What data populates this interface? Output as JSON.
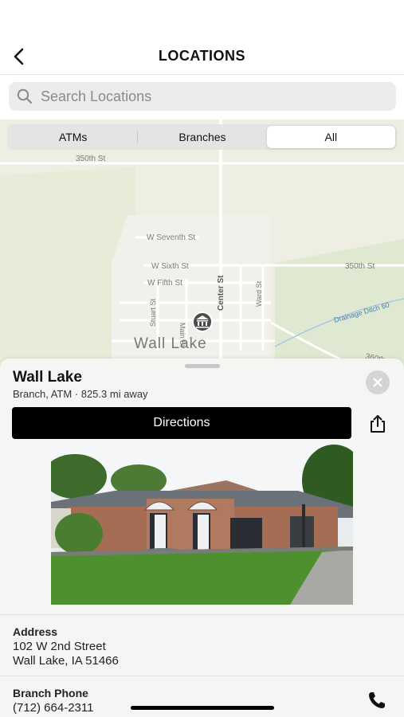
{
  "header": {
    "title": "LOCATIONS",
    "back_icon": "chevron-left-icon"
  },
  "search": {
    "placeholder": "Search Locations",
    "value": ""
  },
  "filter": {
    "options": [
      "ATMs",
      "Branches",
      "All"
    ],
    "selected": "All"
  },
  "map": {
    "place_label": "Wall Lake",
    "streets": [
      "350th St",
      "W Seventh St",
      "W Sixth St",
      "W Fifth St",
      "Center St",
      "Ward St",
      "Stuart St",
      "Main St",
      "350th St",
      "Drainage Ditch 60",
      "360th"
    ],
    "marker_icon": "bank-icon"
  },
  "detail": {
    "name": "Wall Lake",
    "subtitle": "Branch, ATM · 825.3 mi away",
    "directions_label": "Directions",
    "address_label": "Address",
    "address_line1": "102 W 2nd Street",
    "address_line2": "Wall Lake, IA 51466",
    "phone_label": "Branch Phone",
    "phone": "(712) 664-2311"
  },
  "colors": {
    "map_bg": "#eeeee2",
    "button": "#000000",
    "sheet": "#f5f5f3"
  }
}
